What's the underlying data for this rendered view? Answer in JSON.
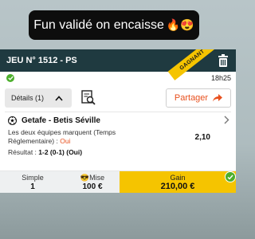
{
  "caption": {
    "text": "Fun validé on encaisse",
    "emojis": "🔥😍"
  },
  "bet": {
    "header": "JEU N° 1512 - PS",
    "ribbon": "GAGNANT",
    "time": "18h25",
    "details_label": "Détails (1)",
    "share_label": "Partager",
    "match": "Getafe - Betis Séville",
    "market_line1": "Les deux équipes marquent (Temps",
    "market_line2": "Réglementaire) :",
    "market_choice": "Oui",
    "odds": "2,10",
    "result_label": "Résultat :",
    "result_value": "1-2 (0-1) (Oui)",
    "simple_label": "Simple",
    "simple_value": "1",
    "mise_label": "Mise",
    "mise_emoji": "😎",
    "mise_value": "100 €",
    "gain_label": "Gain",
    "gain_value": "210,00 €"
  },
  "colors": {
    "header_bg": "#1f3a40",
    "gain_bg": "#f5c400",
    "accent": "#e8501e",
    "success": "#4caf2c"
  },
  "icons": [
    "fire-emoji",
    "heart-eyes-emoji",
    "trash-icon",
    "check-icon",
    "chevron-up-icon",
    "document-search-icon",
    "share-arrow-icon",
    "soccer-ball-icon",
    "chevron-right-icon",
    "sunglasses-emoji"
  ]
}
